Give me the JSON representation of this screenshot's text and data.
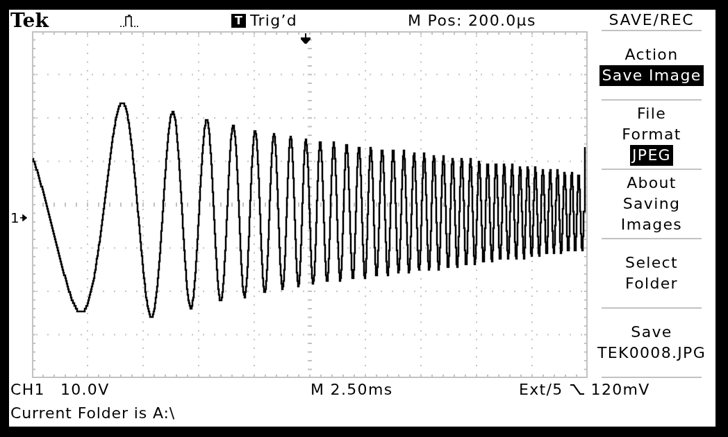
{
  "header": {
    "brand": "Tek",
    "trigger": {
      "badge": "T",
      "status": "Trig’d"
    },
    "horizontal_position": "M Pos: 200.0µs"
  },
  "menu": {
    "title": "SAVE/REC",
    "items": [
      {
        "kind": "option",
        "label_lines": [
          "Action"
        ],
        "value": "Save Image"
      },
      {
        "kind": "option",
        "label_lines": [
          "File",
          "Format"
        ],
        "value": "JPEG"
      },
      {
        "kind": "action",
        "label_lines": [
          "About",
          "Saving",
          "Images"
        ]
      },
      {
        "kind": "action",
        "label_lines": [
          "Select",
          "Folder"
        ]
      },
      {
        "kind": "action",
        "label_lines": [
          "Save",
          "TEK0008.JPG"
        ]
      }
    ]
  },
  "display": {
    "channel_marker": "1"
  },
  "readouts": {
    "channel": "CH1",
    "scale": "10.0V",
    "timebase": "M 2.50ms",
    "trigger_source": "Ext/5",
    "trigger_level": "120mV"
  },
  "status_message": "Current Folder is A:\\"
}
